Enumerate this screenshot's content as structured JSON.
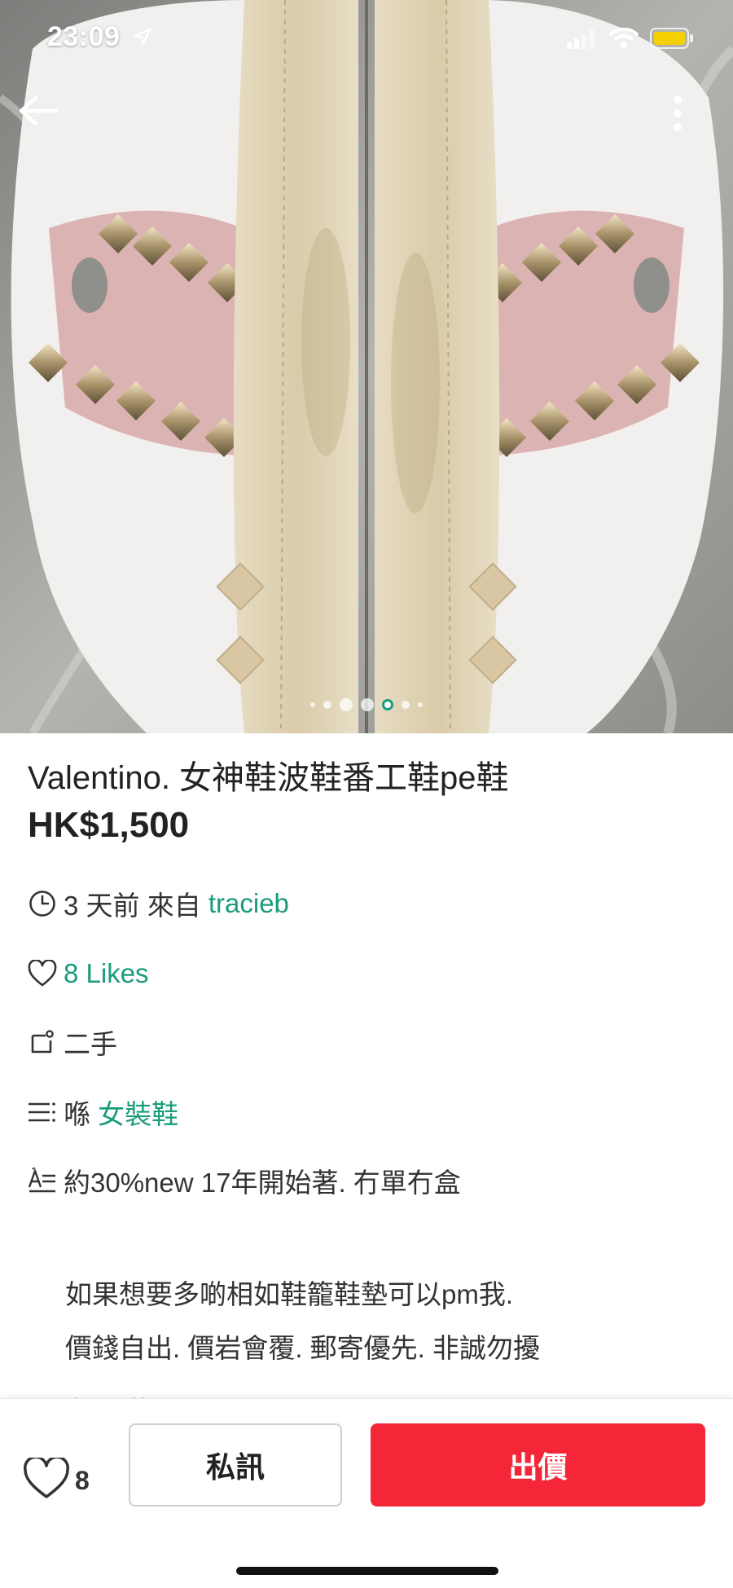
{
  "status_bar": {
    "time": "23:09",
    "icons": [
      "location-arrow-icon",
      "signal-icon",
      "wifi-icon",
      "battery-icon"
    ],
    "battery_color": "#f5d000"
  },
  "nav": {
    "back_icon": "arrow-left-icon",
    "more_icon": "more-vertical-icon"
  },
  "gallery": {
    "image_count": 7,
    "active_index": 4,
    "accent_color": "#1a9c7c"
  },
  "listing": {
    "title": "Valentino. 女神鞋波鞋番工鞋pe鞋",
    "price": "HK$1,500",
    "posted_ago": "3 天前 來自 ",
    "seller": "tracieb",
    "likes": "8 Likes",
    "condition": "二手",
    "category_prefix": "喺 ",
    "category": "女裝鞋",
    "description_line1": "約30%new 17年開始著. 冇單冇盒",
    "description_line2": "如果想要多啲相如鞋籠鞋墊可以pm我.",
    "description_line3": "價錢自出. 價岩會覆. 郵寄優先. 非誠勿擾",
    "faded_line": "產品品牌"
  },
  "actions": {
    "like_count": "8",
    "chat_label": "私訊",
    "offer_label": "出價",
    "offer_color": "#f42637"
  }
}
